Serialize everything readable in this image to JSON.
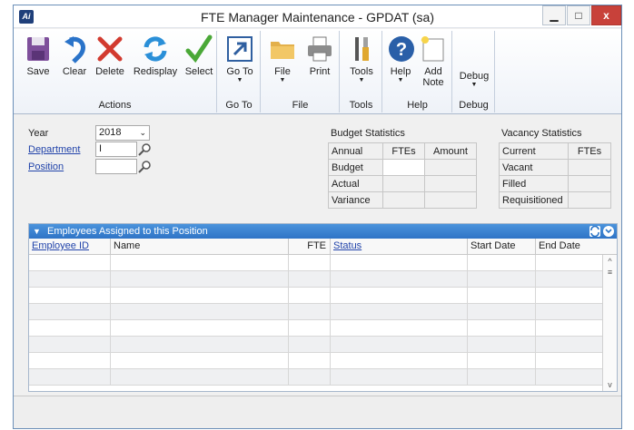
{
  "window": {
    "title": "FTE Manager Maintenance  -  GPDAT (sa)",
    "min_glyph": "▁",
    "max_glyph": "□",
    "close_glyph": "x",
    "app_icon_text": "Ai"
  },
  "ribbon": {
    "groups": [
      {
        "label": "Actions",
        "buttons": [
          {
            "label": "Save",
            "icon": "save-icon"
          },
          {
            "label": "Clear",
            "icon": "undo-icon"
          },
          {
            "label": "Delete",
            "icon": "delete-icon"
          },
          {
            "label": "Redisplay",
            "icon": "refresh-icon"
          },
          {
            "label": "Select",
            "icon": "checkmark-icon"
          }
        ]
      },
      {
        "label": "Go To",
        "buttons": [
          {
            "label": "Go To",
            "icon": "goto-arrow-icon",
            "dropdown": true
          }
        ]
      },
      {
        "label": "File",
        "buttons": [
          {
            "label": "File",
            "icon": "folder-icon",
            "dropdown": true
          },
          {
            "label": "Print",
            "icon": "printer-icon"
          }
        ]
      },
      {
        "label": "Tools",
        "buttons": [
          {
            "label": "Tools",
            "icon": "tools-icon",
            "dropdown": true
          }
        ]
      },
      {
        "label": "Help",
        "buttons": [
          {
            "label": "Help",
            "icon": "help-icon",
            "dropdown": true
          },
          {
            "label": "Add Note",
            "label_line1": "Add",
            "label_line2": "Note",
            "icon": "note-icon"
          }
        ]
      },
      {
        "label": "Debug",
        "buttons": [
          {
            "label": "Debug",
            "dropdown": true
          }
        ]
      }
    ],
    "dropdown_glyph": "▼"
  },
  "form": {
    "year_label": "Year",
    "year_value": "2018",
    "department_label": "Department",
    "department_value": "I",
    "position_label": "Position",
    "position_value": ""
  },
  "budget_statistics": {
    "title": "Budget Statistics",
    "headers": [
      "Annual",
      "FTEs",
      "Amount"
    ],
    "rows": [
      "Budget",
      "Actual",
      "Variance"
    ]
  },
  "vacancy_statistics": {
    "title": "Vacancy Statistics",
    "headers": [
      "Current",
      "FTEs"
    ],
    "rows": [
      "Vacant",
      "Filled",
      "Requisitioned"
    ]
  },
  "employees": {
    "title": "Employees Assigned to this Position",
    "columns": [
      "Employee ID",
      "Name",
      "FTE",
      "Status",
      "Start Date",
      "End Date"
    ],
    "row_count": 8,
    "scroll_up_glyph": "^",
    "scroll_thumb_glyph": "≡",
    "scroll_down_glyph": "v"
  }
}
